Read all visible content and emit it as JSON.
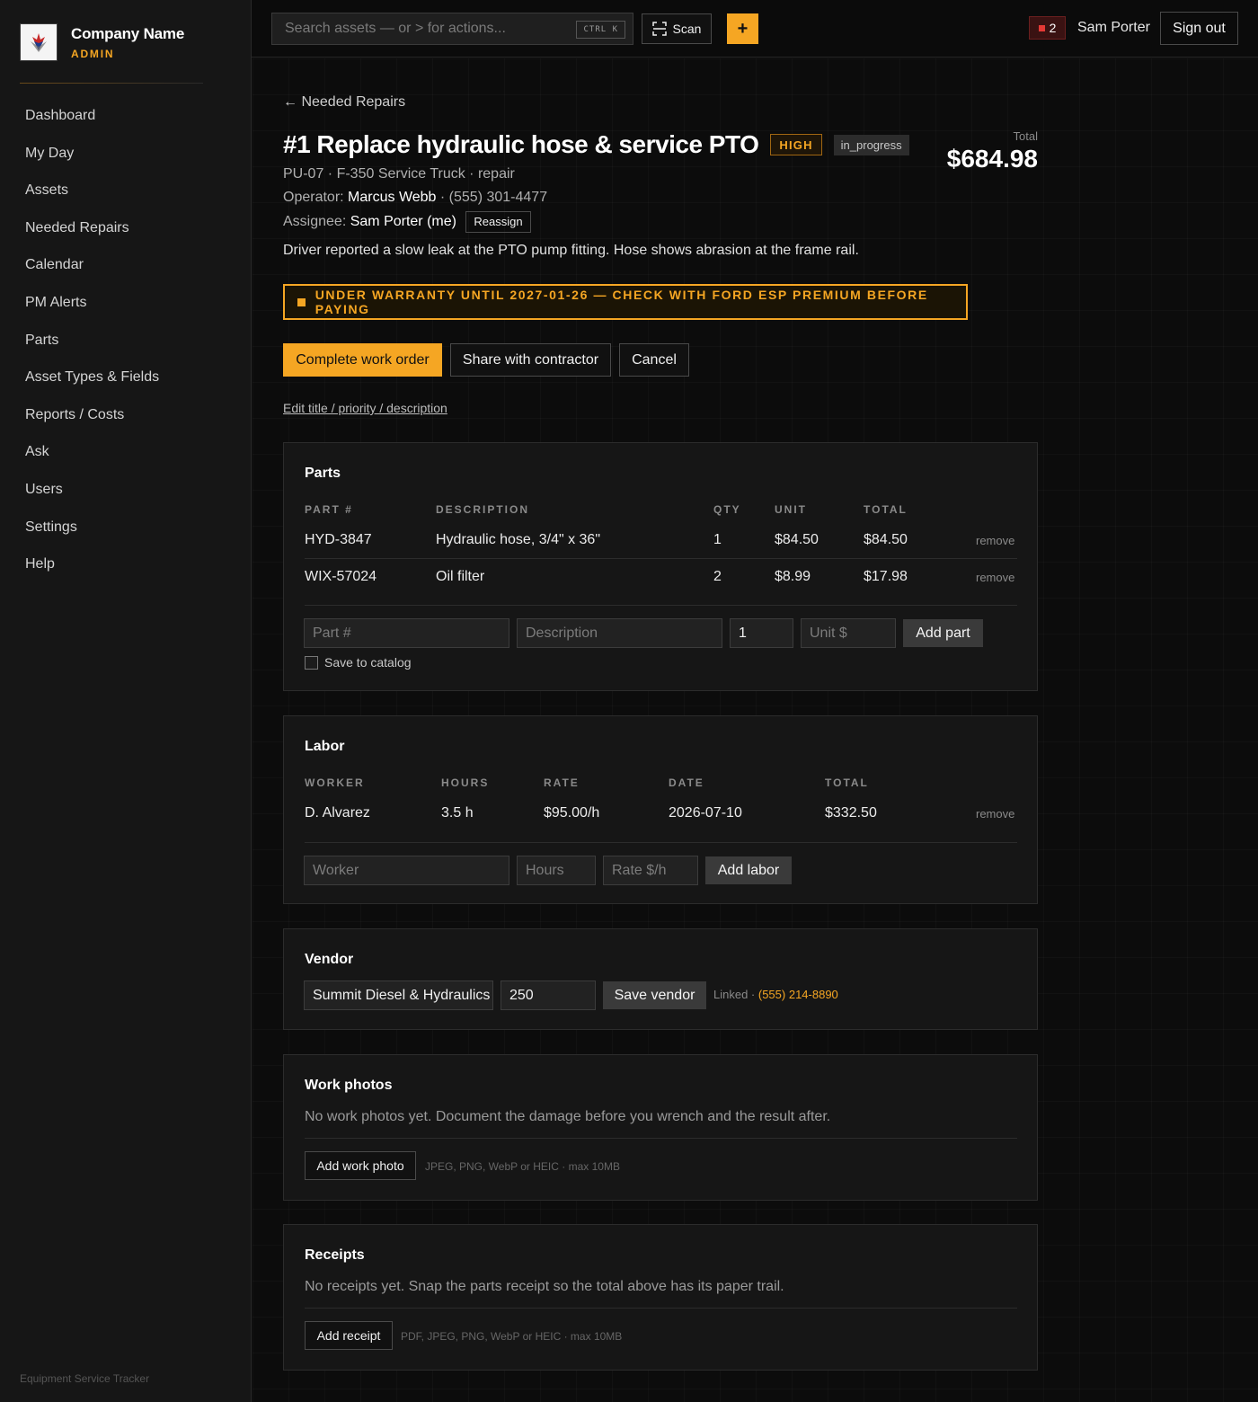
{
  "brand": {
    "name": "Company Name",
    "role": "ADMIN",
    "footer": "Equipment Service Tracker"
  },
  "nav": [
    "Dashboard",
    "My Day",
    "Assets",
    "Needed Repairs",
    "Calendar",
    "PM Alerts",
    "Parts",
    "Asset Types & Fields",
    "Reports / Costs",
    "Ask",
    "Users",
    "Settings",
    "Help"
  ],
  "topbar": {
    "search_placeholder": "Search assets — or > for actions...",
    "search_shortcut": "CTRL K",
    "scan_label": "Scan",
    "plus_label": "+",
    "alert_count": "2",
    "user_name": "Sam Porter",
    "signout_label": "Sign out"
  },
  "work_order": {
    "back_label": "← Needed Repairs",
    "title": "#1 Replace hydraulic hose & service PTO",
    "priority": "HIGH",
    "status": "in_progress",
    "total_label": "Total",
    "total_value": "$684.98",
    "asset_line": "PU-07 · F-350 Service Truck · repair",
    "operator_label": "Operator:",
    "operator_name": "Marcus Webb",
    "operator_phone": "· (555) 301-4477",
    "assignee_label": "Assignee:",
    "assignee_name": "Sam Porter (me)",
    "reassign_label": "Reassign",
    "description": "Driver reported a slow leak at the PTO pump fitting. Hose shows abrasion at the frame rail.",
    "warranty_text": "UNDER WARRANTY UNTIL 2027-01-26 — CHECK WITH FORD ESP PREMIUM BEFORE PAYING",
    "complete_label": "Complete work order",
    "share_label": "Share with contractor",
    "cancel_label": "Cancel",
    "edit_link": "Edit title / priority / description"
  },
  "parts": {
    "title": "Parts",
    "headers": [
      "PART #",
      "DESCRIPTION",
      "QTY",
      "UNIT",
      "TOTAL"
    ],
    "rows": [
      {
        "part": "HYD-3847",
        "description": "Hydraulic hose, 3/4\" x 36\"",
        "qty": "1",
        "unit": "$84.50",
        "total": "$84.50",
        "remove": "remove"
      },
      {
        "part": "WIX-57024",
        "description": "Oil filter",
        "qty": "2",
        "unit": "$8.99",
        "total": "$17.98",
        "remove": "remove"
      }
    ],
    "form": {
      "part_placeholder": "Part #",
      "description_placeholder": "Description",
      "qty_value": "1",
      "unit_placeholder": "Unit $",
      "add_label": "Add part",
      "save_catalog_label": "Save to catalog"
    }
  },
  "labor": {
    "title": "Labor",
    "headers": [
      "WORKER",
      "HOURS",
      "RATE",
      "DATE",
      "TOTAL"
    ],
    "rows": [
      {
        "worker": "D. Alvarez",
        "hours": "3.5 h",
        "rate": "$95.00/h",
        "date": "2026-07-10",
        "total": "$332.50",
        "remove": "remove"
      }
    ],
    "form": {
      "worker_placeholder": "Worker",
      "hours_placeholder": "Hours",
      "rate_placeholder": "Rate $/h",
      "add_label": "Add labor"
    }
  },
  "vendor": {
    "title": "Vendor",
    "name_value": "Summit Diesel & Hydraulics",
    "amount_value": "250",
    "save_label": "Save vendor",
    "linked_label": "Linked ·",
    "linked_phone": "(555) 214-8890"
  },
  "photos": {
    "title": "Work photos",
    "empty_text": "No work photos yet. Document the damage before you wrench and the result after.",
    "add_label": "Add work photo",
    "hint": "JPEG, PNG, WebP or HEIC · max 10MB"
  },
  "receipts": {
    "title": "Receipts",
    "empty_text": "No receipts yet. Snap the parts receipt so the total above has its paper trail.",
    "add_label": "Add receipt",
    "hint": "PDF, JPEG, PNG, WebP or HEIC · max 10MB"
  },
  "colors": {
    "accent": "#f5a623",
    "background": "#0b0b0b",
    "panel": "#161616",
    "danger": "#e53935"
  },
  "icons": [
    "company-logo-icon",
    "scan-icon",
    "plus-icon",
    "alert-square-icon",
    "warning-square-icon",
    "back-arrow-icon"
  ]
}
